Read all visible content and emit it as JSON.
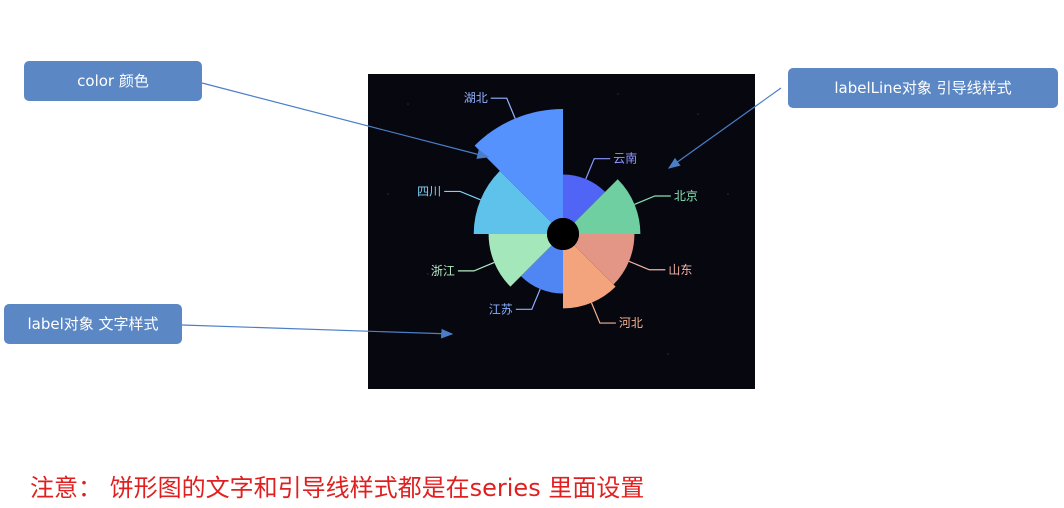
{
  "callouts": {
    "color": "color 颜色",
    "label_line": "labelLine对象 引导线样式",
    "label": "label对象 文字样式"
  },
  "note": "注意： 饼形图的文字和引导线样式都是在series 里面设置",
  "colors": {
    "callout_bg": "#5b87c5",
    "panel_bg": "#070710",
    "note": "#e02020",
    "arrow": "#4a7fc8"
  },
  "chart_data": {
    "type": "pie",
    "variant": "rose",
    "title": "",
    "categories": [
      "云南",
      "北京",
      "山东",
      "河北",
      "江苏",
      "浙江",
      "四川",
      "湖北"
    ],
    "values": [
      20,
      26,
      24,
      25,
      20,
      25,
      30,
      42
    ],
    "colors": [
      "#5065f5",
      "#6fcfa0",
      "#e39586",
      "#f4a47c",
      "#4f86f4",
      "#a3e7ba",
      "#5ec2ea",
      "#5592fd"
    ],
    "label_colors": [
      "#8c99ff",
      "#86e0b2",
      "#f4b3a3",
      "#f4b394",
      "#8ab0ff",
      "#b4ecc4",
      "#7fd2f4",
      "#93b4ff"
    ],
    "start_angle_deg": 90,
    "clockwise": true,
    "equal_angles": true,
    "inner_radius_ratio": 0.24,
    "legend": "none"
  }
}
